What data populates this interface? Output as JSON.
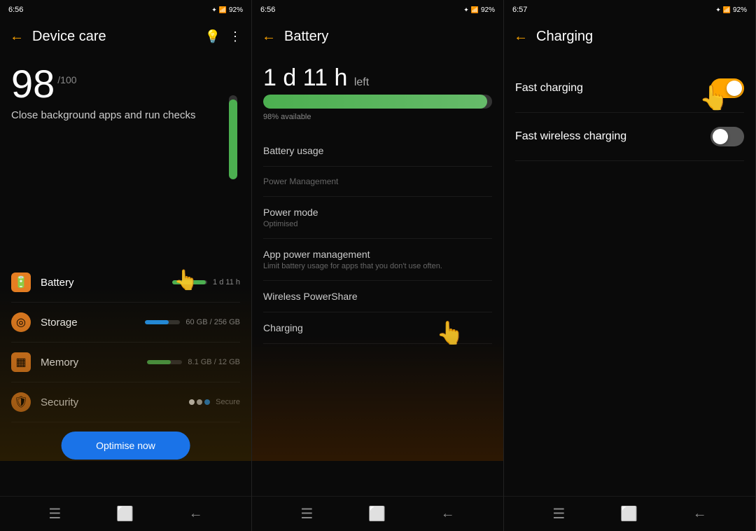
{
  "screen1": {
    "status": {
      "time": "6:56",
      "battery": "92%"
    },
    "title": "Device care",
    "score": "98",
    "score_max": "/100",
    "description": "Close background apps and run checks",
    "menu_items": [
      {
        "name": "Battery",
        "icon": "🟧",
        "color": "battery",
        "bar_width": "95",
        "bar_color": "green",
        "value": "1 d 11 h"
      },
      {
        "name": "Storage",
        "icon": "🟧",
        "color": "storage",
        "bar_width": "70",
        "bar_color": "blue",
        "value": "60 GB / 256 GB"
      },
      {
        "name": "Memory",
        "icon": "🟧",
        "color": "memory",
        "bar_width": "65",
        "bar_color": "green",
        "value": "8.1 GB / 12 GB"
      },
      {
        "name": "Security",
        "icon": "🟧",
        "color": "security",
        "bar_width": "0",
        "bar_color": "",
        "value": "Secure",
        "dots": true
      }
    ],
    "optimise_label": "Optimise now"
  },
  "screen2": {
    "status": {
      "time": "6:56",
      "battery": "92%"
    },
    "title": "Battery",
    "time_left": "1 d 11 h",
    "time_left_suffix": "left",
    "battery_percent": "98",
    "available_text": "98% available",
    "menu_items": [
      {
        "name": "Battery usage",
        "subtitle": ""
      },
      {
        "name": "Power Management",
        "subtitle": ""
      },
      {
        "name": "Power mode",
        "subtitle": "Optimised"
      },
      {
        "name": "App power management",
        "subtitle": "Limit battery usage for apps that you don't use often."
      },
      {
        "name": "Wireless PowerShare",
        "subtitle": ""
      },
      {
        "name": "Charging",
        "subtitle": ""
      }
    ]
  },
  "screen3": {
    "status": {
      "time": "6:57",
      "battery": "92%"
    },
    "title": "Charging",
    "settings": [
      {
        "name": "Fast charging",
        "enabled": true
      },
      {
        "name": "Fast wireless charging",
        "enabled": false
      }
    ]
  },
  "icons": {
    "back": "←",
    "bulb": "💡",
    "more": "⋮",
    "nav_menu": "☰",
    "nav_home": "□",
    "nav_back": "←"
  }
}
